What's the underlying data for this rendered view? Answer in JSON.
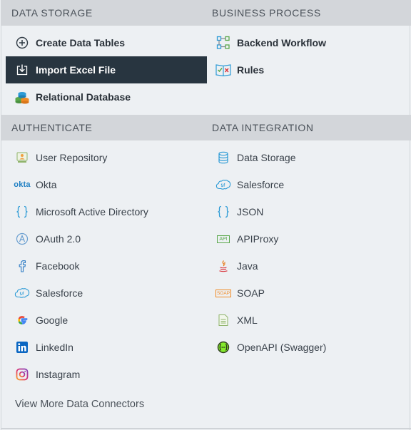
{
  "sections": {
    "data_storage": {
      "title": "DATA STORAGE",
      "items": [
        {
          "label": "Create Data Tables",
          "icon": "plus-circle-icon"
        },
        {
          "label": "Import Excel File",
          "icon": "import-icon",
          "active": true
        },
        {
          "label": "Relational Database",
          "icon": "database-stack-icon"
        }
      ]
    },
    "business_process": {
      "title": "BUSINESS PROCESS",
      "items": [
        {
          "label": "Backend Workflow",
          "icon": "workflow-icon"
        },
        {
          "label": "Rules",
          "icon": "rules-book-icon"
        }
      ]
    },
    "authenticate": {
      "title": "AUTHENTICATE",
      "items": [
        {
          "label": "User Repository",
          "icon": "user-repository-icon"
        },
        {
          "label": "Okta",
          "icon": "okta-logo-icon"
        },
        {
          "label": "Microsoft Active Directory",
          "icon": "braces-icon"
        },
        {
          "label": "OAuth 2.0",
          "icon": "oauth-icon"
        },
        {
          "label": "Facebook",
          "icon": "facebook-icon"
        },
        {
          "label": "Salesforce",
          "icon": "salesforce-icon"
        },
        {
          "label": "Google",
          "icon": "google-icon"
        },
        {
          "label": "LinkedIn",
          "icon": "linkedin-icon"
        },
        {
          "label": "Instagram",
          "icon": "instagram-icon"
        }
      ]
    },
    "data_integration": {
      "title": "DATA INTEGRATION",
      "items": [
        {
          "label": "Data Storage",
          "icon": "database-icon"
        },
        {
          "label": "Salesforce",
          "icon": "salesforce-icon"
        },
        {
          "label": "JSON",
          "icon": "braces-icon"
        },
        {
          "label": "APIProxy",
          "icon": "api-badge-icon"
        },
        {
          "label": "Java",
          "icon": "java-icon"
        },
        {
          "label": "SOAP",
          "icon": "soap-badge-icon"
        },
        {
          "label": "XML",
          "icon": "xml-doc-icon"
        },
        {
          "label": "OpenAPI (Swagger)",
          "icon": "swagger-icon"
        }
      ]
    }
  },
  "badges": {
    "okta": "okta",
    "api": "API",
    "soap": "SOAP"
  },
  "footer": {
    "more_label": "View More Data Connectors"
  },
  "colors": {
    "accent_blue": "#1e88c8",
    "active_bg": "#283540",
    "header_bg": "#d3d6da",
    "panel_bg": "#edf0f3",
    "green": "#5aa84b",
    "orange": "#f08a24",
    "red": "#d9363e"
  }
}
